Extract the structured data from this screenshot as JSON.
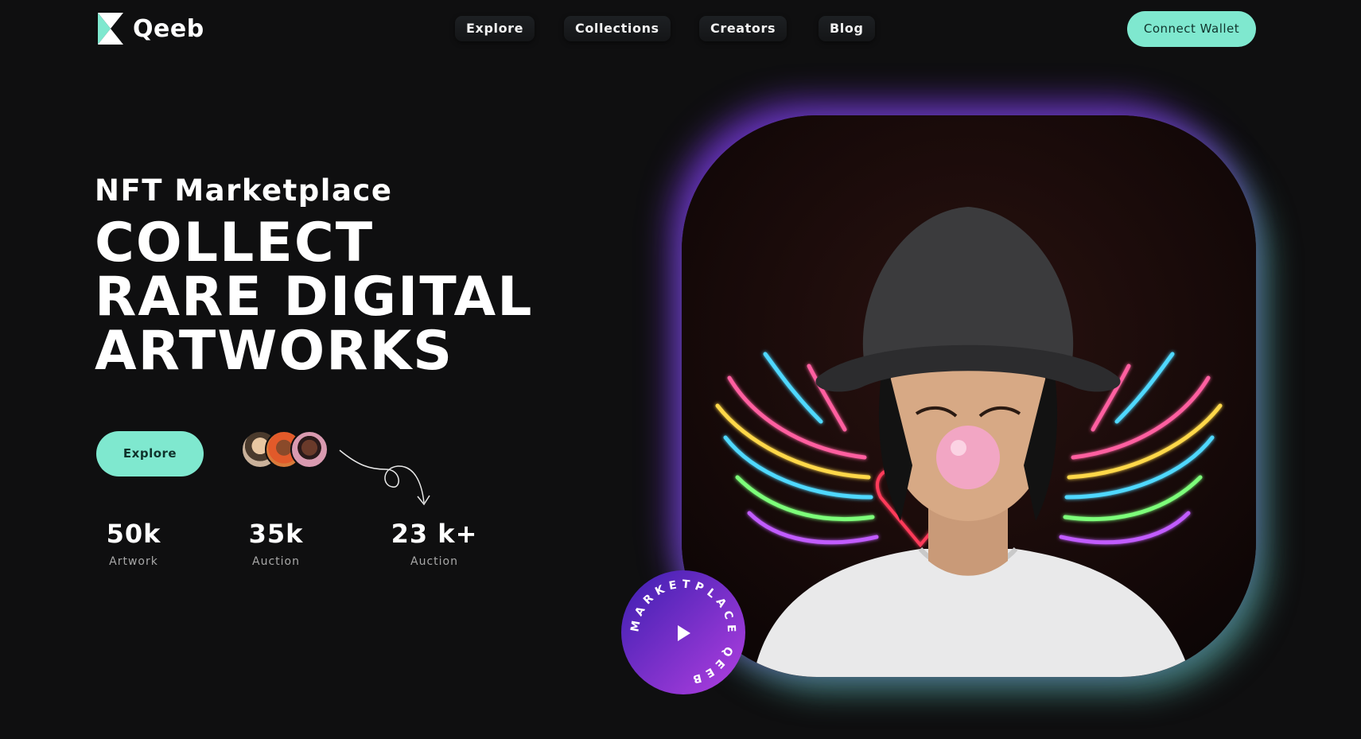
{
  "brand": {
    "name": "Qeeb"
  },
  "nav": {
    "items": [
      {
        "label": "Explore"
      },
      {
        "label": "Collections"
      },
      {
        "label": "Creators"
      },
      {
        "label": "Blog"
      }
    ],
    "connect_label": "Connect Wallet"
  },
  "hero": {
    "eyebrow": "NFT Marketplace",
    "headline_lines": [
      "COLLECT",
      "RARE DIGITAL",
      "ARTWORKS"
    ],
    "cta_label": "Explore",
    "badge_text": "MARKETPLACE QEEB",
    "stats": [
      {
        "value": "50k",
        "label": "Artwork"
      },
      {
        "value": "35k",
        "label": "Auction"
      },
      {
        "value": "23 k+",
        "label": "Auction"
      }
    ]
  },
  "colors": {
    "background": "#0f0f10",
    "accent_mint": "#7fe8cf",
    "glow_purple": "#7c38e6",
    "glow_teal": "#6edcd2"
  },
  "icons": {
    "logo": "qeeb-logo-icon",
    "play": "play-icon",
    "arrow": "curly-arrow-icon"
  }
}
